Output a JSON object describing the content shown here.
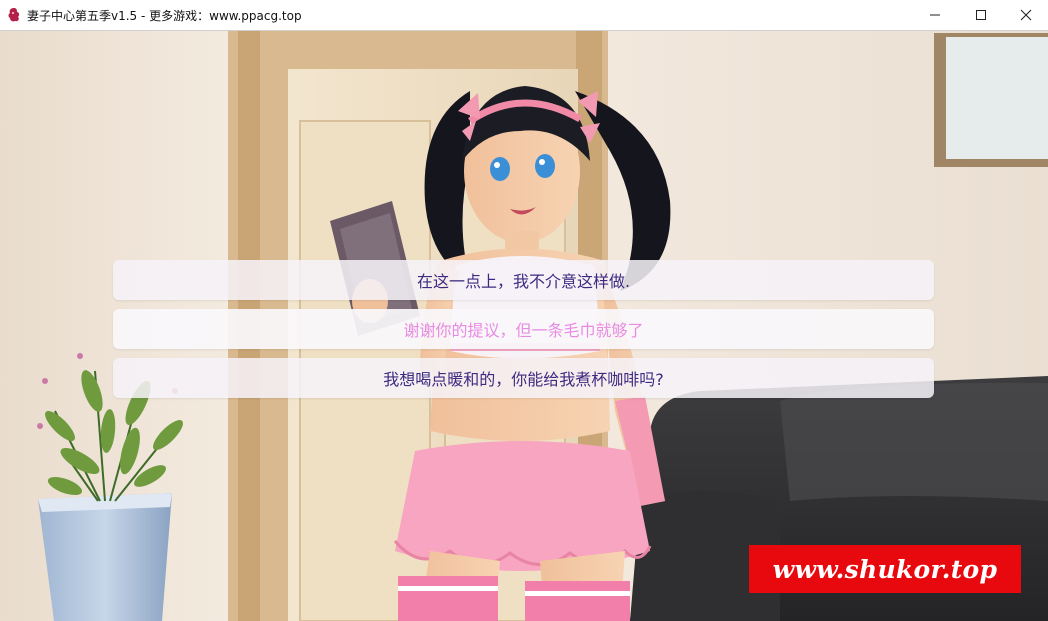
{
  "window": {
    "title": "妻子中心第五季v1.5 - 更多游戏：www.ppacg.top",
    "app_icon": "game-app-icon",
    "controls": [
      "minimize-icon",
      "maximize-icon",
      "close-icon"
    ]
  },
  "dialogue": {
    "choices": [
      {
        "label": "在这一点上，我不介意这样做.",
        "selected": false
      },
      {
        "label": "谢谢你的提议，但一条毛巾就够了",
        "selected": true
      },
      {
        "label": "我想喝点暖和的，你能给我煮杯咖啡吗?",
        "selected": false
      }
    ]
  },
  "watermark": {
    "text": "www.shukor.top",
    "color": "#e8090f"
  },
  "colors": {
    "choice_text": "#3d2b82",
    "choice_text_hover": "#e88be3",
    "choice_background": "#f6f2f8"
  }
}
